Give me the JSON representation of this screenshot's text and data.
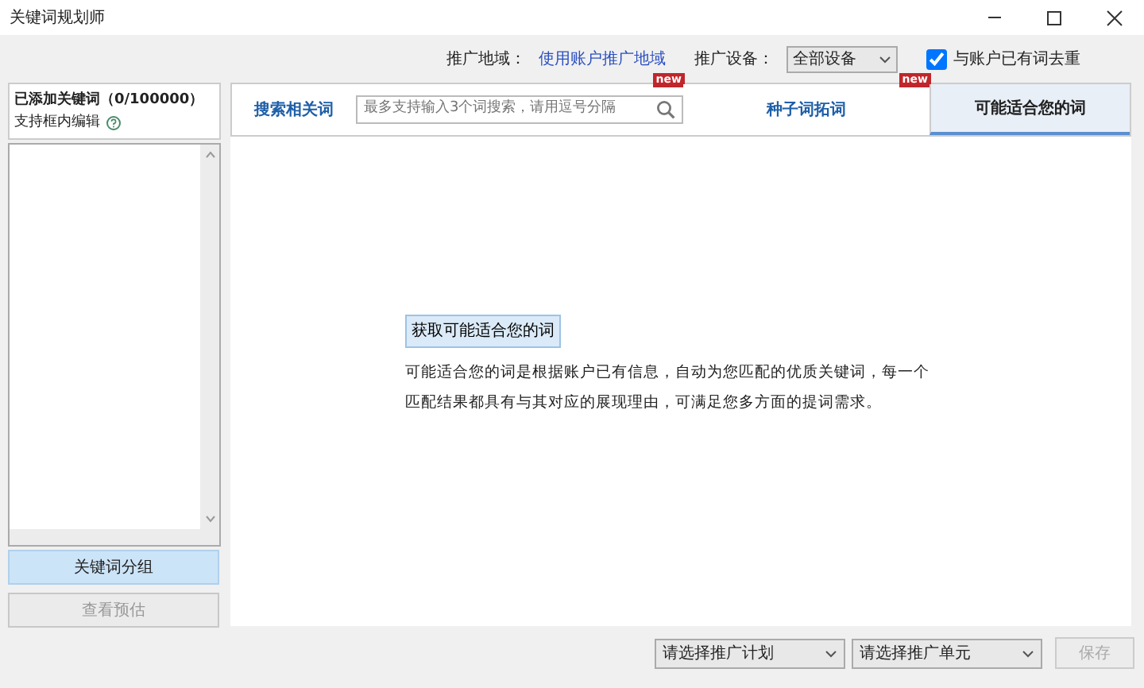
{
  "window": {
    "title": "关键词规划师"
  },
  "toolbar": {
    "region_label": "推广地域：",
    "region_link": "使用账户推广地域",
    "device_label": "推广设备：",
    "device_value": "全部设备",
    "dedupe": {
      "label": "与账户已有词去重",
      "checked": true
    }
  },
  "sidebar": {
    "title": "已添加关键词（0/100000）",
    "subtitle": "支持框内编辑",
    "buttons": [
      {
        "label": "关键词分组",
        "selected": true,
        "disabled": false
      },
      {
        "label": "查看预估",
        "selected": false,
        "disabled": true
      }
    ]
  },
  "tabs": [
    {
      "kind": "tab",
      "label": "搜索相关词",
      "selected": false
    },
    {
      "kind": "search",
      "placeholder": "最多支持输入3个词搜索，请用逗号分隔",
      "badge": "new"
    },
    {
      "kind": "tab",
      "label": "种子词拓词",
      "selected": false,
      "badge": "new"
    },
    {
      "kind": "tab",
      "label": "可能适合您的词",
      "selected": true
    }
  ],
  "content": {
    "button": "获取可能适合您的词",
    "description": "可能适合您的词是根据账户已有信息，自动为您匹配的优质关键词，每一个匹配结果都具有与其对应的展现理由，可满足您多方面的提词需求。"
  },
  "footer": {
    "plan_select": "请选择推广计划",
    "unit_select": "请选择推广单元",
    "save": {
      "label": "保存",
      "disabled": true
    }
  }
}
